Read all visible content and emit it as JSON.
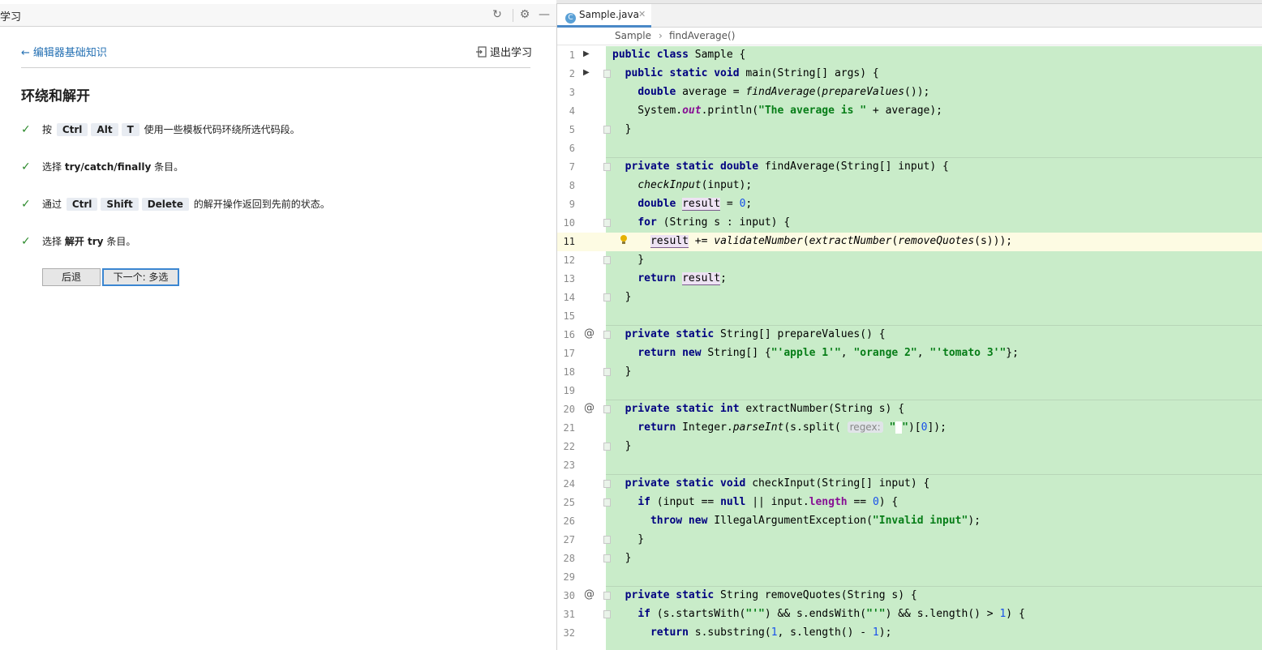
{
  "left_panel": {
    "title": "学习",
    "back_link": "编辑器基础知识",
    "exit_link": "退出学习",
    "lesson_title": "环绕和解开",
    "steps": [
      {
        "pre": "按",
        "keys": [
          "Ctrl",
          "Alt",
          "T"
        ],
        "post": "使用一些模板代码环绕所选代码段。"
      },
      {
        "pre": "选择",
        "bold": "try/catch/finally",
        "post": "条目。"
      },
      {
        "pre": "通过",
        "keys": [
          "Ctrl",
          "Shift",
          "Delete"
        ],
        "post": "的解开操作返回到先前的状态。"
      },
      {
        "pre": "选择",
        "bold": "解开 try",
        "post": "条目。"
      }
    ],
    "buttons": {
      "back": "后退",
      "next": "下一个: 多选"
    }
  },
  "editor": {
    "tab": {
      "file_name": "Sample.java",
      "icon": "java-class-icon"
    },
    "breadcrumbs": [
      "Sample",
      "findAverage()"
    ],
    "current_line": 11,
    "colors": {
      "changed_bg": "#c9ecc9",
      "current_line_bg": "#fdfbe3",
      "keyword": "#000080",
      "string": "#067d17",
      "number": "#1750eb",
      "field": "#871094"
    },
    "line_numbers": [
      "1",
      "2",
      "3",
      "4",
      "5",
      "6",
      "7",
      "8",
      "9",
      "10",
      "11",
      "12",
      "13",
      "14",
      "15",
      "16",
      "17",
      "18",
      "19",
      "20",
      "21",
      "22",
      "23",
      "24",
      "25",
      "26",
      "27",
      "28",
      "29",
      "30",
      "31",
      "32"
    ],
    "inlay_hint": "regex:"
  }
}
